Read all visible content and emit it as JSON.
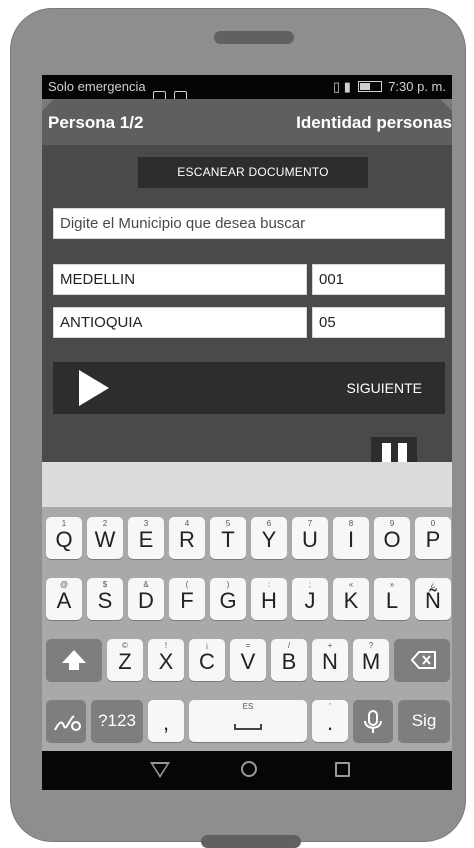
{
  "status": {
    "carrier": "Solo emergencia",
    "time": "7:30 p. m.",
    "icons": [
      "sim-icon",
      "image-icon",
      "vibrate-icon",
      "signal-icon",
      "battery-icon"
    ]
  },
  "appbar": {
    "left_title": "Persona 1/2",
    "right_title": "Identidad personas"
  },
  "scan_button": "ESCANEAR DOCUMENTO",
  "search": {
    "placeholder": "Digite el Municipio que desea buscar"
  },
  "municipio": {
    "name": "MEDELLIN",
    "code": "001"
  },
  "departamento": {
    "name": "ANTIOQUIA",
    "code": "05"
  },
  "next_button": "SIGUIENTE",
  "keyboard": {
    "row1": [
      {
        "main": "Q",
        "sub": "1"
      },
      {
        "main": "W",
        "sub": "2"
      },
      {
        "main": "E",
        "sub": "3"
      },
      {
        "main": "R",
        "sub": "4"
      },
      {
        "main": "T",
        "sub": "5"
      },
      {
        "main": "Y",
        "sub": "6"
      },
      {
        "main": "U",
        "sub": "7"
      },
      {
        "main": "I",
        "sub": "8"
      },
      {
        "main": "O",
        "sub": "9"
      },
      {
        "main": "P",
        "sub": "0"
      }
    ],
    "row2": [
      {
        "main": "A",
        "sub": "@"
      },
      {
        "main": "S",
        "sub": "$"
      },
      {
        "main": "D",
        "sub": "&"
      },
      {
        "main": "F",
        "sub": "("
      },
      {
        "main": "G",
        "sub": ")"
      },
      {
        "main": "H",
        "sub": ":"
      },
      {
        "main": "J",
        "sub": ";"
      },
      {
        "main": "K",
        "sub": "«"
      },
      {
        "main": "L",
        "sub": "»"
      },
      {
        "main": "Ñ",
        "sub": "¿"
      }
    ],
    "row3": [
      {
        "main": "Z",
        "sub": "©"
      },
      {
        "main": "X",
        "sub": "!"
      },
      {
        "main": "C",
        "sub": "¡"
      },
      {
        "main": "V",
        "sub": "="
      },
      {
        "main": "B",
        "sub": "/"
      },
      {
        "main": "N",
        "sub": "+"
      },
      {
        "main": "M",
        "sub": "?"
      }
    ],
    "symbols": "?123",
    "comma": ",",
    "space_hint": "ES",
    "period": ".",
    "period_sub": "'",
    "enter": "Sig"
  }
}
